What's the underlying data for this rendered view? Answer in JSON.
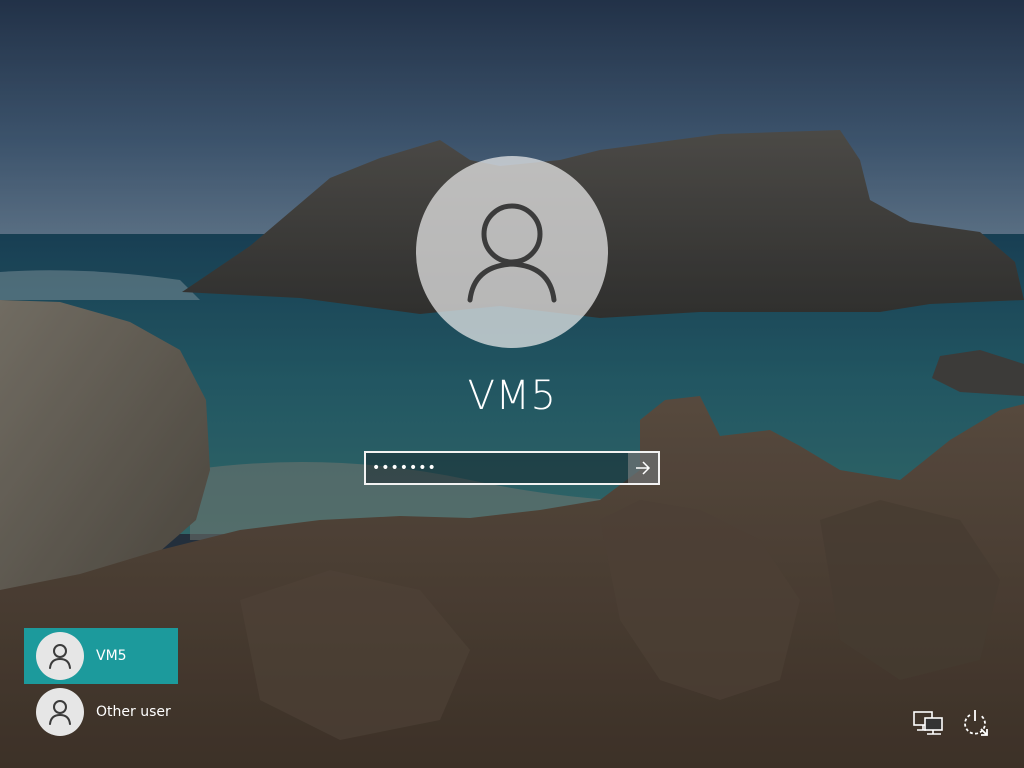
{
  "login": {
    "username": "VM5",
    "password_mask": "•••••••"
  },
  "users": [
    {
      "name": "VM5",
      "selected": true
    },
    {
      "name": "Other user",
      "selected": false
    }
  ],
  "icons": {
    "avatar": "person-icon",
    "submit": "arrow-right-icon",
    "network": "network-icon",
    "ease_of_access": "ease-of-access-icon",
    "power": "power-icon"
  },
  "colors": {
    "selected_tile": "#1c9a9c",
    "text": "#ffffff",
    "avatar_bg": "#e6e6e6"
  }
}
